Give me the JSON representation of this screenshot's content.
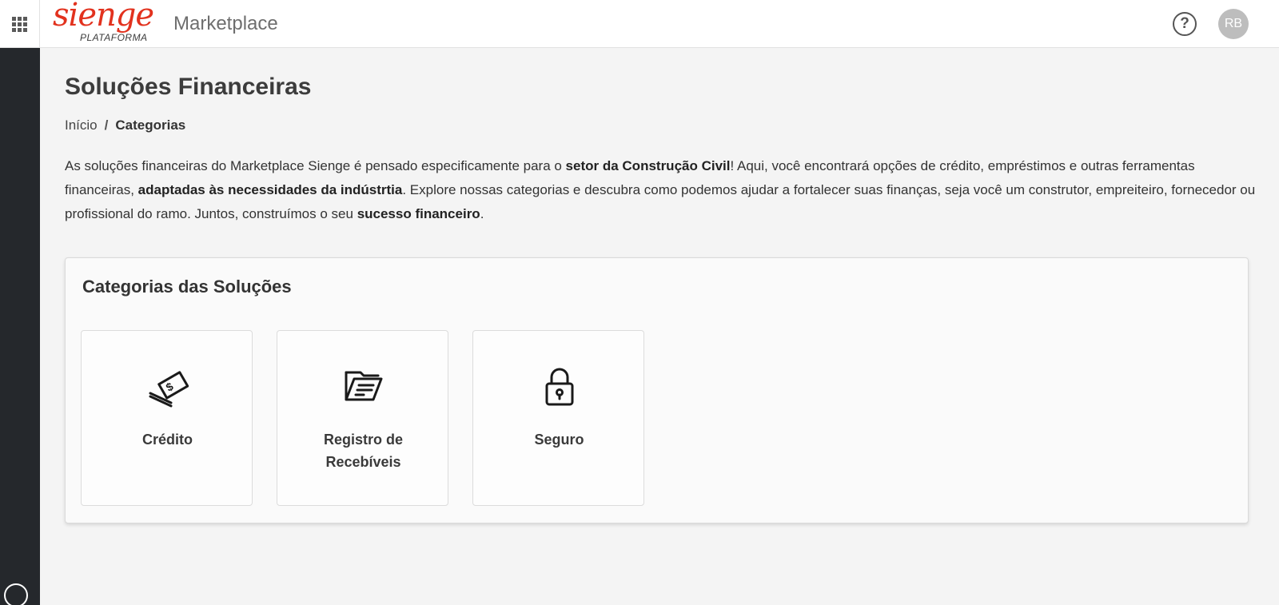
{
  "header": {
    "logo_word": "sienge",
    "logo_sub": "PLATAFORMA",
    "app_title": "Marketplace",
    "help_label": "?",
    "avatar_initials": "RB"
  },
  "page": {
    "title": "Soluções Financeiras",
    "breadcrumb": {
      "home": "Início",
      "separator": "/",
      "current": "Categorias"
    }
  },
  "intro": {
    "t1": "As soluções financeiras do Marketplace Sienge é pensado especificamente para o ",
    "b1": "setor da Construção Civil",
    "t2": "! Aqui, você encontrará opções de crédito, empréstimos e outras ferramentas financeiras, ",
    "b2": "adaptadas às necessidades da indústrtia",
    "t3": ". Explore nossas categorias e descubra como podemos ajudar a fortalecer suas finanças, seja você um construtor, empreiteiro, fornecedor ou profissional do ramo. Juntos, construímos o seu ",
    "b3": "sucesso financeiro",
    "t4": "."
  },
  "categories": {
    "title": "Categorias das Soluções",
    "items": [
      {
        "label": "Crédito",
        "icon": "money-bills-icon"
      },
      {
        "label": "Registro de Recebíveis",
        "icon": "folder-document-icon"
      },
      {
        "label": "Seguro",
        "icon": "padlock-icon"
      }
    ]
  },
  "colors": {
    "brand": "#e2321e",
    "sidebar": "#25282c",
    "page_background": "#f4f4f4"
  }
}
